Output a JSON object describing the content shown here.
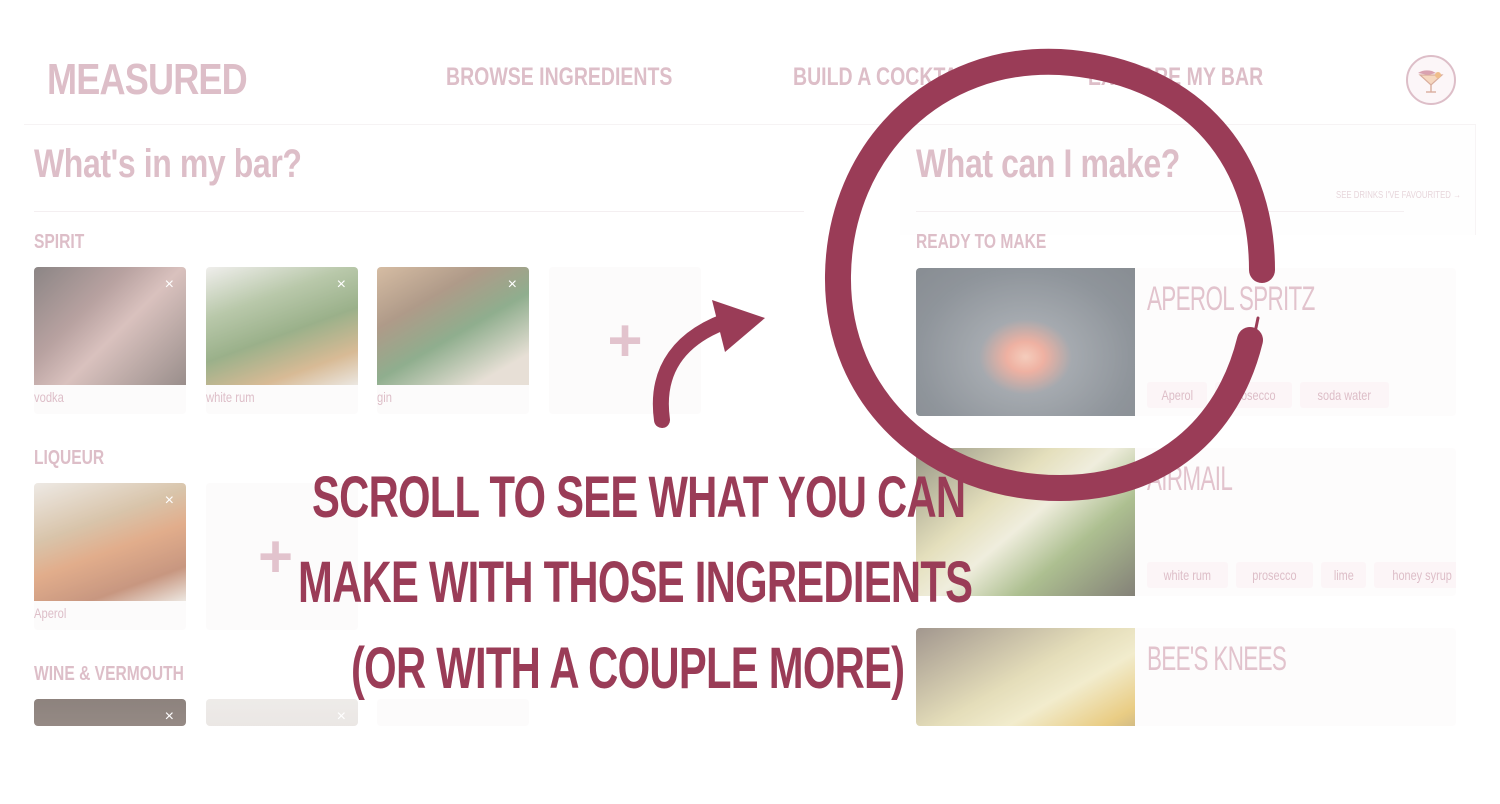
{
  "header": {
    "logo": "MEASURED",
    "nav": [
      "BROWSE INGREDIENTS",
      "BUILD A COCKTAIL",
      "EXPLORE MY BAR"
    ]
  },
  "left": {
    "title": "What's in my bar?",
    "sections": [
      {
        "label": "SPIRIT",
        "items": [
          "vodka",
          "white rum",
          "gin"
        ]
      },
      {
        "label": "LIQUEUR",
        "items": [
          "Aperol"
        ]
      },
      {
        "label": "WINE & VERMOUTH",
        "items": []
      }
    ],
    "close_glyph": "×",
    "add_glyph": "+"
  },
  "right": {
    "title": "What can I make?",
    "see_favourites": "SEE DRINKS I'VE FAVOURITED →",
    "section_label": "READY TO MAKE",
    "drinks": [
      {
        "name": "APEROL SPRITZ",
        "tags": [
          "Aperol",
          "prosecco",
          "soda water"
        ]
      },
      {
        "name": "AIRMAIL",
        "tags": [
          "white rum",
          "prosecco",
          "lime",
          "honey syrup"
        ]
      },
      {
        "name": "BEE'S KNEES",
        "tags": []
      }
    ]
  },
  "banner": {
    "line1": "SCROLL TO SEE WHAT YOU CAN",
    "line2": "MAKE WITH THOSE INGREDIENTS",
    "line3": "(OR WITH A COUPLE MORE)"
  },
  "colors": {
    "accent": "#9a3c57",
    "muted_pink": "#cfa2b0"
  }
}
